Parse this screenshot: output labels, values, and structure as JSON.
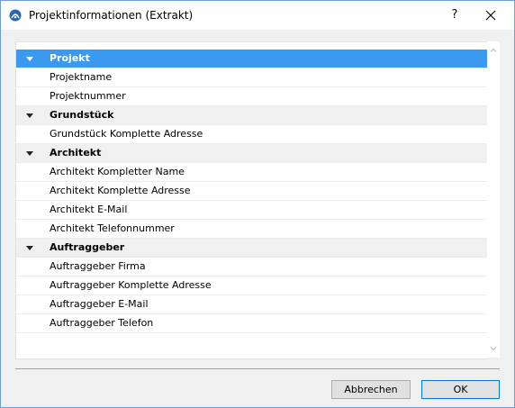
{
  "window": {
    "title": "Projektinformationen (Extrakt)",
    "help_label": "?",
    "accent_color": "#3b99f0"
  },
  "list": {
    "rows": [
      {
        "kind": "header",
        "label": "Projekt",
        "selected": true
      },
      {
        "kind": "item",
        "label": "Projektname"
      },
      {
        "kind": "item",
        "label": "Projektnummer"
      },
      {
        "kind": "header",
        "label": "Grundstück"
      },
      {
        "kind": "item",
        "label": "Grundstück Komplette Adresse"
      },
      {
        "kind": "header",
        "label": "Architekt"
      },
      {
        "kind": "item",
        "label": "Architekt Kompletter Name"
      },
      {
        "kind": "item",
        "label": "Architekt Komplette Adresse"
      },
      {
        "kind": "item",
        "label": "Architekt E-Mail"
      },
      {
        "kind": "item",
        "label": "Architekt Telefonnummer"
      },
      {
        "kind": "header",
        "label": "Auftraggeber"
      },
      {
        "kind": "item",
        "label": "Auftraggeber Firma"
      },
      {
        "kind": "item",
        "label": "Auftraggeber Komplette Adresse"
      },
      {
        "kind": "item",
        "label": "Auftraggeber E-Mail"
      },
      {
        "kind": "item",
        "label": "Auftraggeber Telefon"
      }
    ]
  },
  "buttons": {
    "cancel_label": "Abbrechen",
    "ok_label": "OK"
  },
  "icons": {
    "app": "archicad-logo-icon",
    "help": "help-icon",
    "close": "close-icon",
    "expand": "triangle-down-icon",
    "scroll_up": "chevron-up-icon",
    "scroll_down": "chevron-down-icon"
  }
}
